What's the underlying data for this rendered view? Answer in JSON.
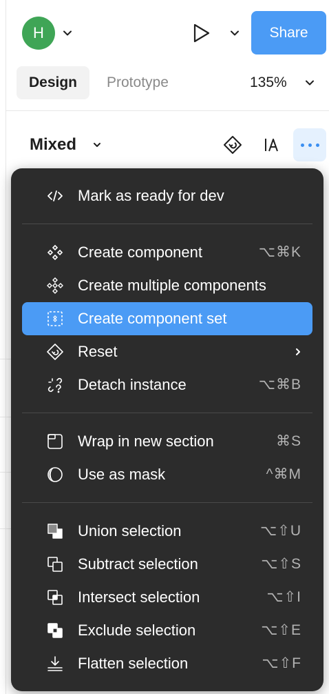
{
  "header": {
    "avatar_letter": "H",
    "share_label": "Share"
  },
  "tabs": {
    "design": "Design",
    "prototype": "Prototype",
    "zoom": "135%"
  },
  "selection": {
    "label": "Mixed"
  },
  "menu": {
    "mark_ready": "Mark as ready for dev",
    "create_component": {
      "label": "Create component",
      "shortcut": "⌥⌘K"
    },
    "create_multiple": {
      "label": "Create multiple components"
    },
    "create_set": {
      "label": "Create component set"
    },
    "reset": {
      "label": "Reset"
    },
    "detach": {
      "label": "Detach instance",
      "shortcut": "⌥⌘B"
    },
    "wrap_section": {
      "label": "Wrap in new section",
      "shortcut": "⌘S"
    },
    "use_mask": {
      "label": "Use as mask",
      "shortcut": "^⌘M"
    },
    "union": {
      "label": "Union selection",
      "shortcut": "⌥⇧U"
    },
    "subtract": {
      "label": "Subtract selection",
      "shortcut": "⌥⇧S"
    },
    "intersect": {
      "label": "Intersect selection",
      "shortcut": "⌥⇧I"
    },
    "exclude": {
      "label": "Exclude selection",
      "shortcut": "⌥⇧E"
    },
    "flatten": {
      "label": "Flatten selection",
      "shortcut": "⌥⇧F"
    }
  },
  "colors": {
    "accent": "#4b9bf5",
    "menu_bg": "#2c2c2c",
    "avatar": "#3fa556"
  }
}
